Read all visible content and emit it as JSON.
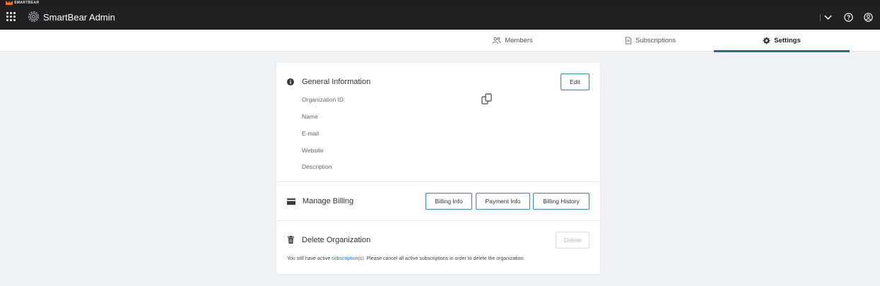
{
  "brand": {
    "wordmark": "SMARTBEAR"
  },
  "header": {
    "title": "SmartBear Admin",
    "icons": [
      "apps-grid-icon",
      "gear-icon",
      "chevron-down-icon",
      "help-icon",
      "user-icon"
    ]
  },
  "tabs": [
    {
      "label": "Members",
      "icon": "members-icon",
      "active": false
    },
    {
      "label": "Subscriptions",
      "icon": "document-icon",
      "active": false
    },
    {
      "label": "Settings",
      "icon": "gear-icon",
      "active": true
    }
  ],
  "general": {
    "title": "General Information",
    "edit_label": "Edit",
    "fields": {
      "org_id": "Organization ID:",
      "name": "Name",
      "email": "E-mail",
      "website": "Website",
      "description": "Description"
    }
  },
  "billing": {
    "title": "Manage Billing",
    "buttons": {
      "info": "Billing Info",
      "payment": "Payment Info",
      "history": "Billing History"
    }
  },
  "delete_org": {
    "title": "Delete Organization",
    "button_label": "Delete",
    "note_prefix": "You still have active ",
    "note_link": "subscription(s)",
    "note_suffix": ". Please cancel all active subscriptions in order to delete the organization."
  },
  "colors": {
    "accent": "#1d6f8f",
    "button_border": "#3b8fb0",
    "link": "#1f6fd0",
    "header_bg": "#1f2123",
    "brand_orange": "#ff6a13"
  }
}
